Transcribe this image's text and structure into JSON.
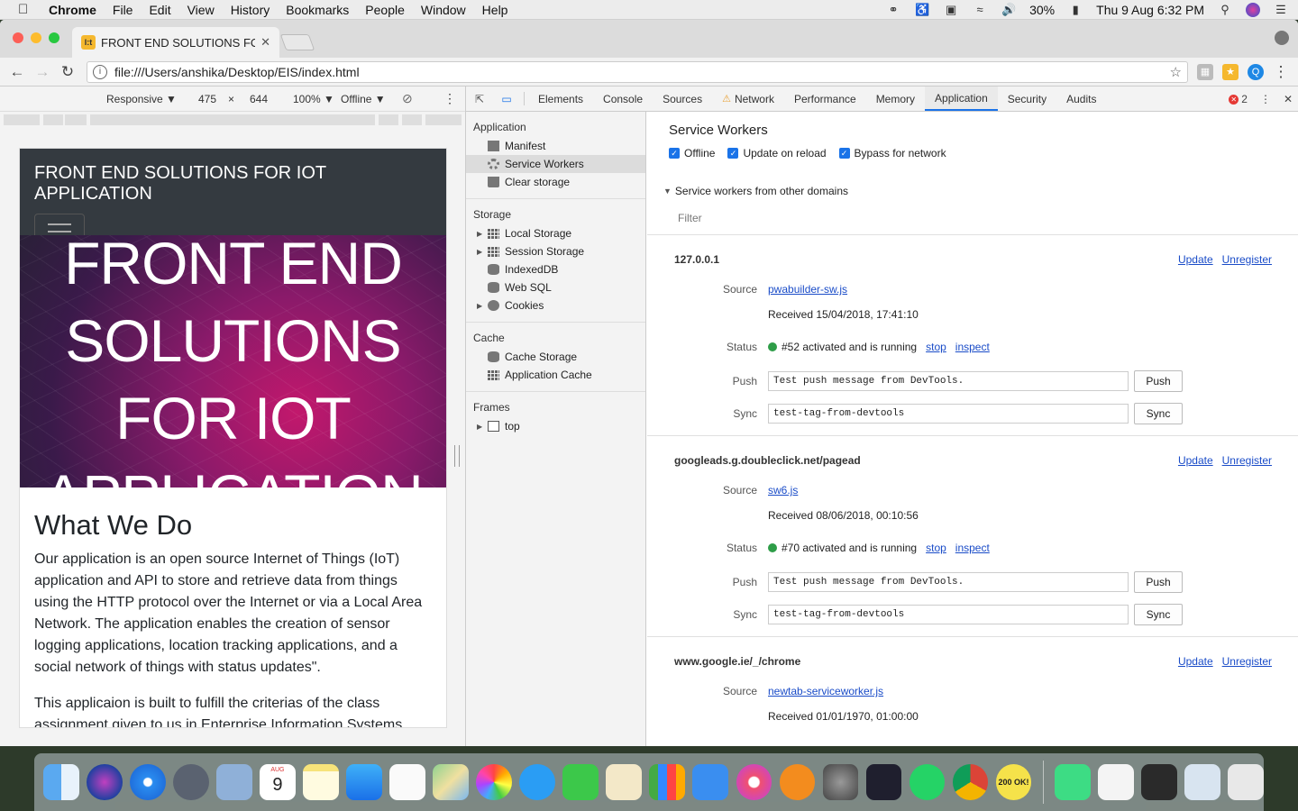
{
  "menubar": {
    "app": "Chrome",
    "menus": [
      "File",
      "Edit",
      "View",
      "History",
      "Bookmarks",
      "People",
      "Window",
      "Help"
    ],
    "battery": "30%",
    "clock": "Thu 9 Aug  6:32 PM"
  },
  "browser": {
    "tab_title": "FRONT END SOLUTIONS FOR IOT APPLICATION",
    "favicon_text": "I:t",
    "url": "file:///Users/anshika/Desktop/EIS/index.html"
  },
  "device_toolbar": {
    "mode": "Responsive ▼",
    "width": "475",
    "times": "×",
    "height": "644",
    "zoom": "100% ▼",
    "network": "Offline ▼"
  },
  "page": {
    "brand": "FRONT END SOLUTIONS FOR IOT APPLICATION",
    "hero_lines": [
      "FRONT END",
      "SOLUTIONS",
      "FOR IOT",
      "APPLICATION"
    ],
    "heading": "What We Do",
    "para1": "Our application is an open source Internet of Things (IoT) application and API to store and retrieve data from things using the HTTP protocol over the Internet or via a Local Area Network. The application enables the creation of sensor logging applications, location tracking applications, and a social network of things with status updates\".",
    "para2": "This applicaion is built to fulfill the criterias of the class assignment given to us in Enterprise Information Systems"
  },
  "devtools": {
    "tabs": [
      "Elements",
      "Console",
      "Sources",
      "Network",
      "Performance",
      "Memory",
      "Application",
      "Security",
      "Audits"
    ],
    "active_tab": "Application",
    "error_count": "2",
    "sidebar": {
      "application_head": "Application",
      "application_items": [
        "Manifest",
        "Service Workers",
        "Clear storage"
      ],
      "storage_head": "Storage",
      "storage_items": [
        "Local Storage",
        "Session Storage",
        "IndexedDB",
        "Web SQL",
        "Cookies"
      ],
      "cache_head": "Cache",
      "cache_items": [
        "Cache Storage",
        "Application Cache"
      ],
      "frames_head": "Frames",
      "frames_items": [
        "top"
      ]
    },
    "main": {
      "title": "Service Workers",
      "options": [
        "Offline",
        "Update on reload",
        "Bypass for network"
      ],
      "other_domains": "Service workers from other domains",
      "filter_placeholder": "Filter",
      "labels": {
        "source": "Source",
        "status": "Status",
        "push": "Push",
        "sync": "Sync"
      },
      "link_update": "Update",
      "link_unregister": "Unregister",
      "link_stop": "stop",
      "link_inspect": "inspect",
      "btn_push": "Push",
      "btn_sync": "Sync",
      "workers": [
        {
          "origin": "127.0.0.1",
          "source": "pwabuilder-sw.js",
          "received": "Received 15/04/2018, 17:41:10",
          "status": "#52 activated and is running",
          "push_value": "Test push message from DevTools.",
          "sync_value": "test-tag-from-devtools"
        },
        {
          "origin": "googleads.g.doubleclick.net/pagead",
          "source": "sw6.js",
          "received": "Received 08/06/2018, 00:10:56",
          "status": "#70 activated and is running",
          "push_value": "Test push message from DevTools.",
          "sync_value": "test-tag-from-devtools"
        },
        {
          "origin": "www.google.ie/_/chrome",
          "source": "newtab-serviceworker.js",
          "received": "Received 01/01/1970, 01:00:00"
        }
      ]
    }
  },
  "dock": {
    "calendar_month": "AUG",
    "calendar_day": "9",
    "sticker_text": "200 OK!"
  }
}
